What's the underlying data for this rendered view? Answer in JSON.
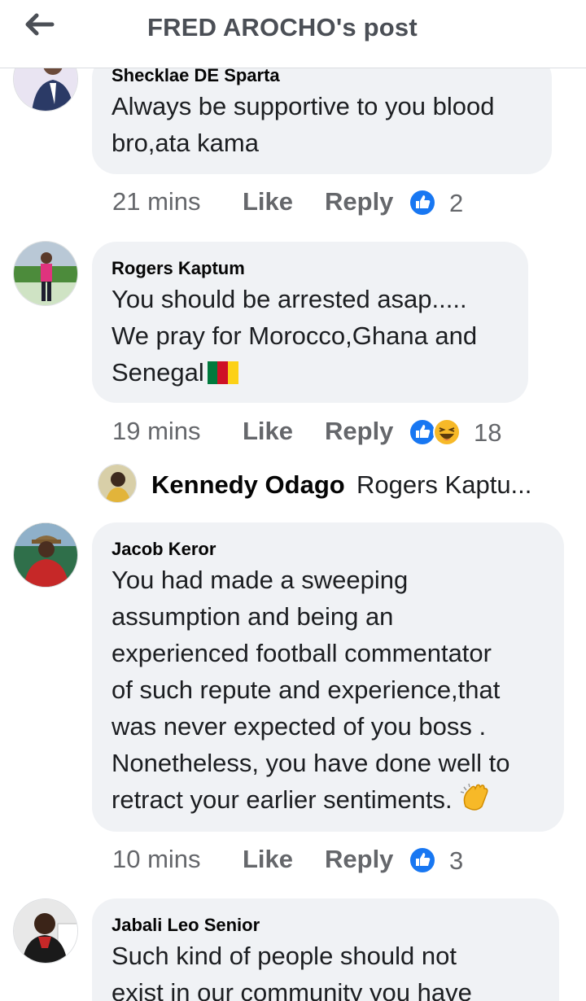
{
  "header": {
    "title": "FRED AROCHO's post",
    "back_icon": "arrow-left-icon"
  },
  "comments": [
    {
      "author": "Shecklae DE Sparta",
      "text": "Always be supportive to you blood\nbro,ata kama",
      "time": "21 mins",
      "like": "Like",
      "reply": "Reply",
      "reactions": [
        "like"
      ],
      "count": "2"
    },
    {
      "author": "Rogers Kaptum",
      "text": "You should be arrested asap.....\nWe pray for Morocco,Ghana and\nSenegal",
      "time": "19 mins",
      "like": "Like",
      "reply": "Reply",
      "reactions": [
        "like",
        "haha"
      ],
      "count": "18",
      "emoji": "cameroon-flag"
    },
    {
      "author": "Jacob Keror",
      "text": "You had made a sweeping\nassumption and being an\nexperienced football commentator\nof such repute and experience,that\nwas never expected of you boss .\nNonetheless, you have done well to\nretract your earlier sentiments.",
      "time": "10 mins",
      "like": "Like",
      "reply": "Reply",
      "reactions": [
        "like"
      ],
      "count": "3",
      "emoji": "clapping-hands"
    },
    {
      "author": "Jabali Leo Senior",
      "text": "Such kind of people should not\nexist in our community you have"
    }
  ],
  "reply_preview": {
    "name": "Kennedy Odago",
    "text": "Rogers Kaptu..."
  },
  "colors": {
    "like_blue": "#1877f2",
    "bubble": "#f0f2f5",
    "meta_gray": "#65676b",
    "haha_yellow": "#f7b928"
  }
}
